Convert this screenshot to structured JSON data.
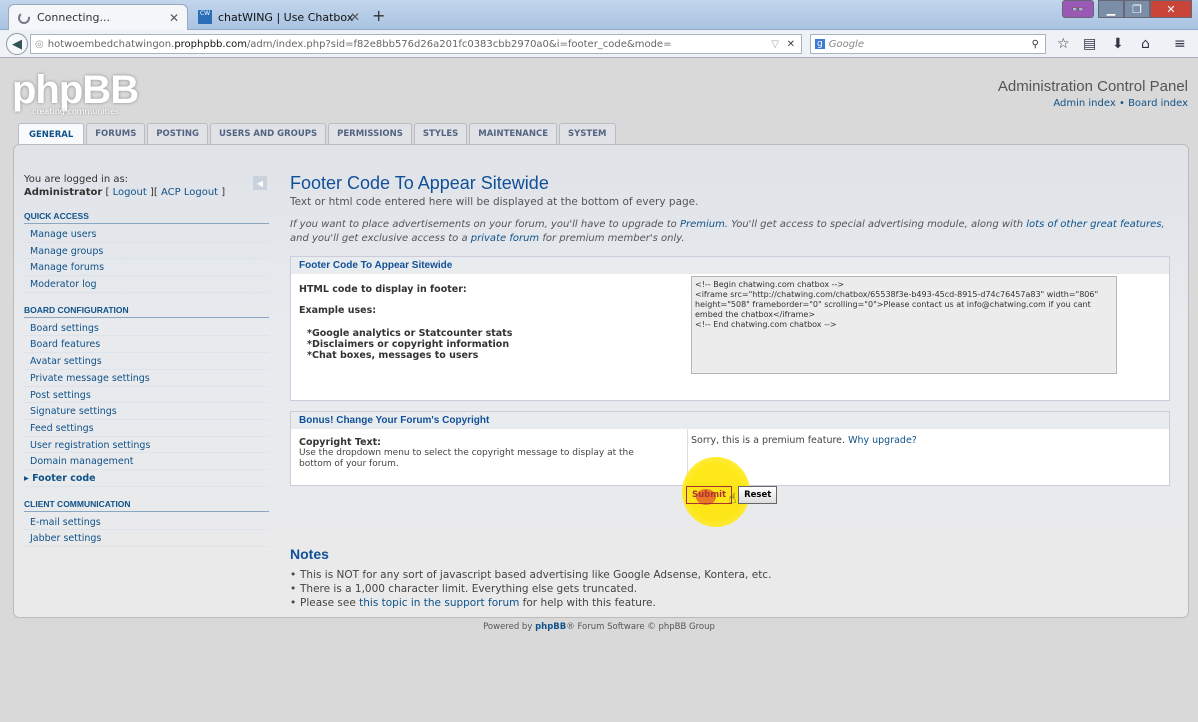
{
  "browser": {
    "tabs": [
      {
        "label": "Connecting...",
        "active": true
      },
      {
        "label": "chatWING | Use Chatbox",
        "active": false
      }
    ],
    "url_prefix": "hotwoembedchatwingon.",
    "url_domain": "prophpbb.com",
    "url_path": "/adm/index.php?sid=f82e8bb576d26a201fc0383cbb2970a0&i=footer_code&mode=",
    "search_placeholder": "Google"
  },
  "header": {
    "logo_text": "phpBB",
    "logo_sub": "creating communities",
    "title": "Administration Control Panel",
    "admin_index": "Admin index",
    "separator": "•",
    "board_index": "Board index"
  },
  "tabs": [
    "GENERAL",
    "FORUMS",
    "POSTING",
    "USERS AND GROUPS",
    "PERMISSIONS",
    "STYLES",
    "MAINTENANCE",
    "SYSTEM"
  ],
  "sidebar": {
    "logged_in_label": "You are logged in as:",
    "user": "Administrator",
    "logout": "Logout",
    "acp_logout": "ACP Logout",
    "sections": [
      {
        "title": "QUICK ACCESS",
        "items": [
          "Manage users",
          "Manage groups",
          "Manage forums",
          "Moderator log"
        ]
      },
      {
        "title": "BOARD CONFIGURATION",
        "items": [
          "Board settings",
          "Board features",
          "Avatar settings",
          "Private message settings",
          "Post settings",
          "Signature settings",
          "Feed settings",
          "User registration settings",
          "Domain management",
          "Footer code"
        ]
      },
      {
        "title": "CLIENT COMMUNICATION",
        "items": [
          "E-mail settings",
          "Jabber settings"
        ]
      }
    ]
  },
  "main": {
    "title": "Footer Code To Appear Sitewide",
    "intro": "Text or html code entered here will be displayed at the bottom of every page.",
    "premium_1": "If you want to place advertisements on your forum, you'll have to upgrade to ",
    "premium_link": "Premium",
    "premium_2": ". You'll get access to special advertising module, along with ",
    "premium_link2": "lots of other great features",
    "premium_3": ", and you'll get exclusive access to a ",
    "premium_link3": "private forum",
    "premium_4": " for premium member's only.",
    "box1_legend": "Footer Code To Appear Sitewide",
    "html_label": "HTML code to display in footer:",
    "example_label": "Example uses:",
    "examples": [
      "*Google analytics or Statcounter stats",
      "*Disclaimers or copyright information",
      "*Chat boxes, messages to users"
    ],
    "code": "<!-- Begin chatwing.com chatbox -->\n<iframe src=\"http://chatwing.com/chatbox/65538f3e-b493-45cd-8915-d74c76457a83\" width=\"806\" height=\"508\" frameborder=\"0\" scrolling=\"0\">Please contact us at info@chatwing.com if you cant embed the chatbox</iframe>\n<!-- End chatwing.com chatbox -->",
    "box2_legend": "Bonus! Change Your Forum's Copyright",
    "copyright_label": "Copyright Text:",
    "copyright_desc": "Use the dropdown menu to select the copyright message to display at the bottom of your forum.",
    "sorry": "Sorry, this is a premium feature. ",
    "why_upgrade": "Why upgrade?",
    "submit": "Submit",
    "reset": "Reset",
    "notes_title": "Notes",
    "note1": "This is NOT for any sort of javascript based advertising like Google Adsense, Kontera, etc.",
    "note2": "There is a 1,000 character limit. Everything else gets truncated.",
    "note3_a": "Please see ",
    "note3_link": "this topic in the support forum",
    "note3_b": " for help with this feature."
  },
  "footer": {
    "a": "Powered by ",
    "link": "phpBB",
    "b": "® Forum Software © phpBB Group"
  }
}
